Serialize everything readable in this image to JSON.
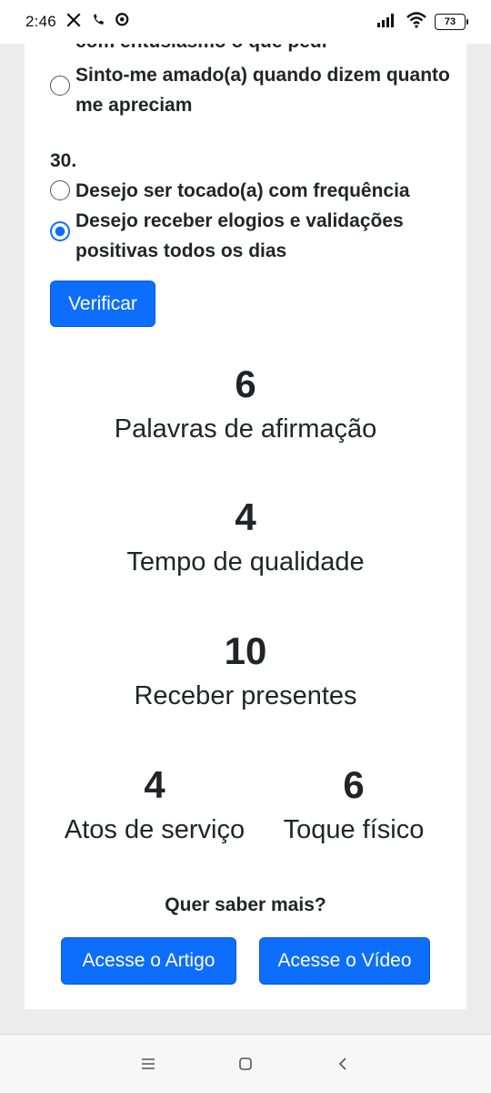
{
  "status_bar": {
    "time": "2:46",
    "battery": "73",
    "icons": [
      "x-logo-icon",
      "phone-icon",
      "chat-icon",
      "signal-icon",
      "wifi-icon",
      "battery-icon"
    ]
  },
  "quiz": {
    "prev_cut_text": "com entusiasmo o que pedi",
    "prev_option_b": {
      "text": "Sinto-me amado(a) quando dizem quanto me apreciam",
      "checked": false
    },
    "question_30": {
      "number": "30.",
      "options": [
        {
          "text": "Desejo ser tocado(a) com frequência",
          "checked": false
        },
        {
          "text": "Desejo receber elogios e validações positivas todos os dias",
          "checked": true
        }
      ]
    },
    "verify_label": "Verificar"
  },
  "results": {
    "words": {
      "value": "6",
      "label": "Palavras de afirmação"
    },
    "quality_time": {
      "value": "4",
      "label": "Tempo de qualidade"
    },
    "gifts": {
      "value": "10",
      "label": "Receber presentes"
    },
    "service": {
      "value": "4",
      "label": "Atos de serviço"
    },
    "touch": {
      "value": "6",
      "label": "Toque físico"
    }
  },
  "more": {
    "question": "Quer saber mais?",
    "article_label": "Acesse o Artigo",
    "video_label": "Acesse o Vídeo"
  },
  "colors": {
    "accent": "#0d6efd",
    "text": "#212529",
    "background": "#ececec"
  },
  "nav_bar": {
    "icons": [
      "menu-icon",
      "home-icon",
      "back-icon"
    ]
  }
}
